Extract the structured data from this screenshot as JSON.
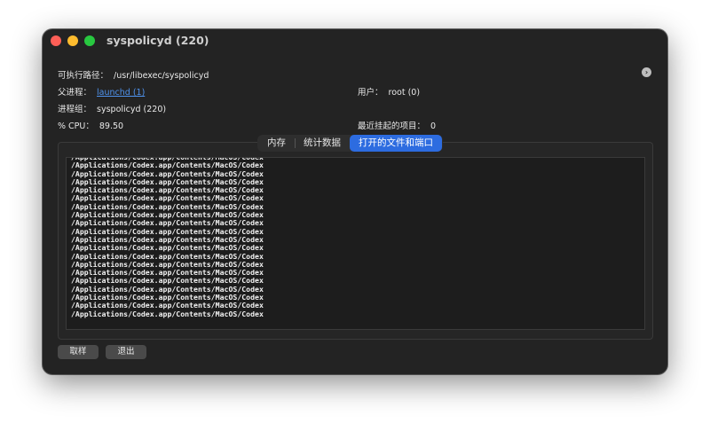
{
  "window": {
    "title": "syspolicyd (220)"
  },
  "info": {
    "exec_path_label": "可执行路径：",
    "exec_path_value": "/usr/libexec/syspolicyd",
    "parent_label": "父进程：",
    "parent_value": "launchd (1)",
    "group_label": "进程组：",
    "group_value": "syspolicyd (220)",
    "cpu_label": "% CPU：",
    "cpu_value": "89.50",
    "user_label": "用户：",
    "user_value": "root (0)",
    "recent_label": "最近挂起的项目：",
    "recent_value": "0"
  },
  "tabs": [
    {
      "label": "内存"
    },
    {
      "label": "统计数据"
    },
    {
      "label": "打开的文件和端口"
    }
  ],
  "files": [
    "/Applications/Codex.app/Contents/MacOS/Codex",
    "/Applications/Codex.app/Contents/MacOS/Codex",
    "/Applications/Codex.app/Contents/MacOS/Codex",
    "/Applications/Codex.app/Contents/MacOS/Codex",
    "/Applications/Codex.app/Contents/MacOS/Codex",
    "/Applications/Codex.app/Contents/MacOS/Codex",
    "/Applications/Codex.app/Contents/MacOS/Codex",
    "/Applications/Codex.app/Contents/MacOS/Codex",
    "/Applications/Codex.app/Contents/MacOS/Codex",
    "/Applications/Codex.app/Contents/MacOS/Codex",
    "/Applications/Codex.app/Contents/MacOS/Codex",
    "/Applications/Codex.app/Contents/MacOS/Codex",
    "/Applications/Codex.app/Contents/MacOS/Codex",
    "/Applications/Codex.app/Contents/MacOS/Codex",
    "/Applications/Codex.app/Contents/MacOS/Codex",
    "/Applications/Codex.app/Contents/MacOS/Codex",
    "/Applications/Codex.app/Contents/MacOS/Codex",
    "/Applications/Codex.app/Contents/MacOS/Codex",
    "/Applications/Codex.app/Contents/MacOS/Codex",
    "/Applications/Codex.app/Contents/MacOS/Codex"
  ],
  "buttons": {
    "cancel_label": "取样",
    "quit_label": "退出"
  },
  "colors": {
    "window_bg": "#232323",
    "accent": "#2d6ce0",
    "link": "#4f93ee",
    "close": "#fe5f57",
    "minimize": "#febc2e",
    "maximize": "#28c840"
  },
  "icons": {
    "info_arrow": "arrow-right-circle-icon"
  }
}
